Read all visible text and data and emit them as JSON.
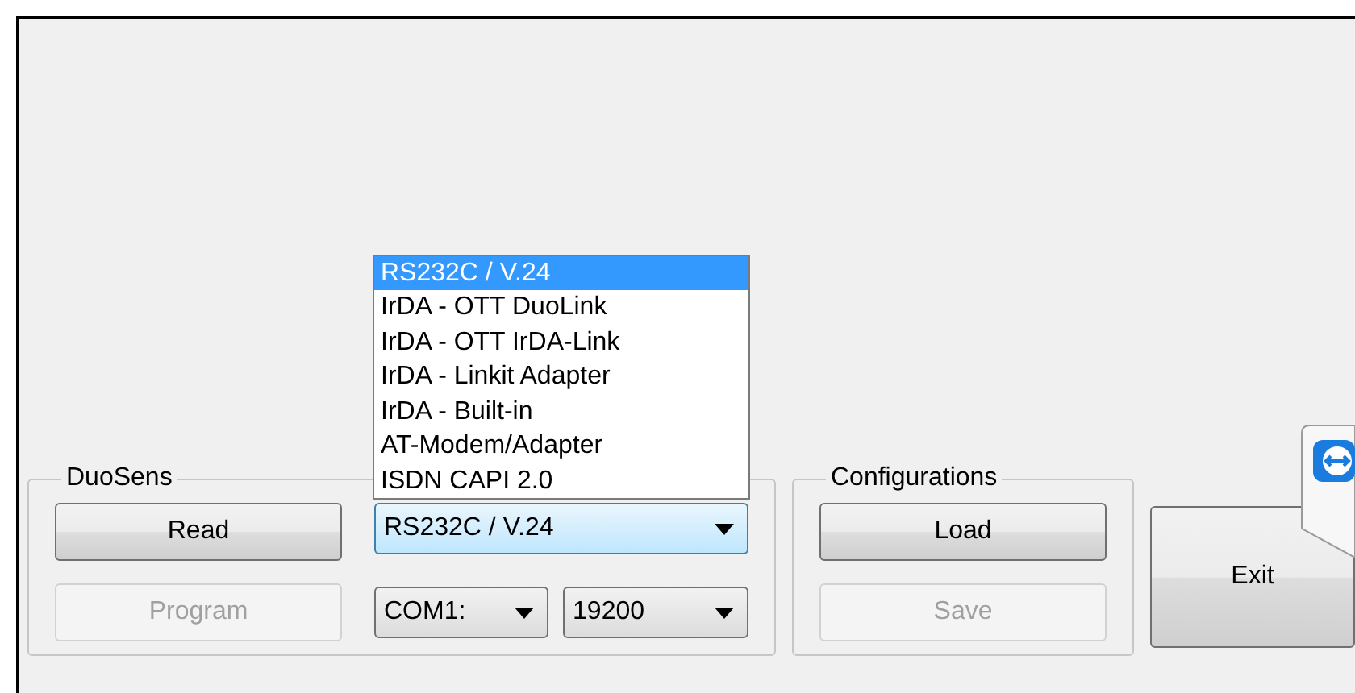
{
  "duosens": {
    "legend": "DuoSens",
    "buttons": [
      {
        "label": "Read",
        "disabled": false
      },
      {
        "label": "Program",
        "disabled": true
      }
    ],
    "interface_combo": {
      "value": "RS232C / V.24",
      "expanded": true,
      "options": [
        {
          "label": "RS232C / V.24",
          "selected": true
        },
        {
          "label": "IrDA - OTT DuoLink",
          "selected": false
        },
        {
          "label": "IrDA - OTT IrDA-Link",
          "selected": false
        },
        {
          "label": "IrDA - Linkit Adapter",
          "selected": false
        },
        {
          "label": "IrDA - Built-in",
          "selected": false
        },
        {
          "label": "AT-Modem/Adapter",
          "selected": false
        },
        {
          "label": "ISDN CAPI 2.0",
          "selected": false
        }
      ]
    },
    "port_combo": {
      "value": "COM1:"
    },
    "baud_combo": {
      "value": "19200"
    }
  },
  "configurations": {
    "legend": "Configurations",
    "buttons": [
      {
        "label": "Load",
        "disabled": false
      },
      {
        "label": "Save",
        "disabled": true
      }
    ]
  },
  "exit_button": {
    "label": "Exit"
  }
}
